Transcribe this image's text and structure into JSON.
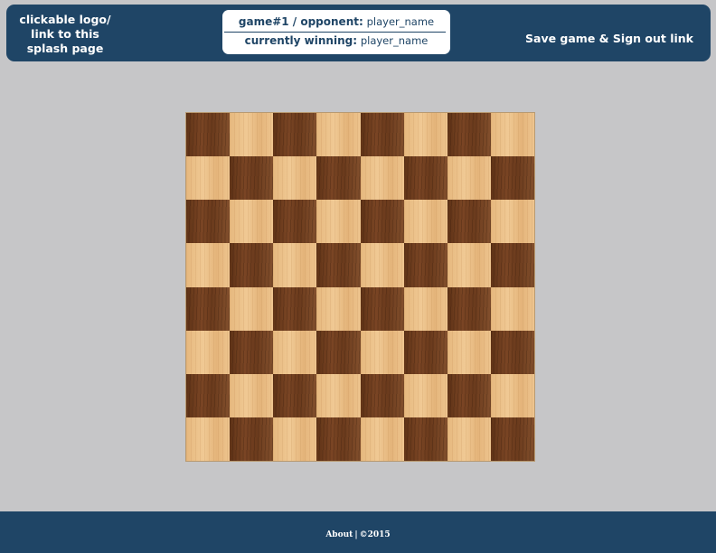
{
  "header": {
    "logo_link": {
      "lines": [
        "clickable logo/",
        "link to this",
        "splash page"
      ]
    },
    "game_info": {
      "game_label": "game#1 / opponent:",
      "opponent_name": "player_name",
      "winning_label": "currently winning:",
      "winning_name": "player_name"
    },
    "save_signout_link": "Save game & Sign out link"
  },
  "board": {
    "rows": 8,
    "columns": 8,
    "top_left_color": "dark",
    "dark_color": "#6e3c1d",
    "light_color": "#ebc089"
  },
  "footer": {
    "about_label": "About",
    "separator": "|",
    "copyright": "©2015"
  },
  "colors": {
    "navy": "#1f4566",
    "background": "#c6c6c8"
  }
}
